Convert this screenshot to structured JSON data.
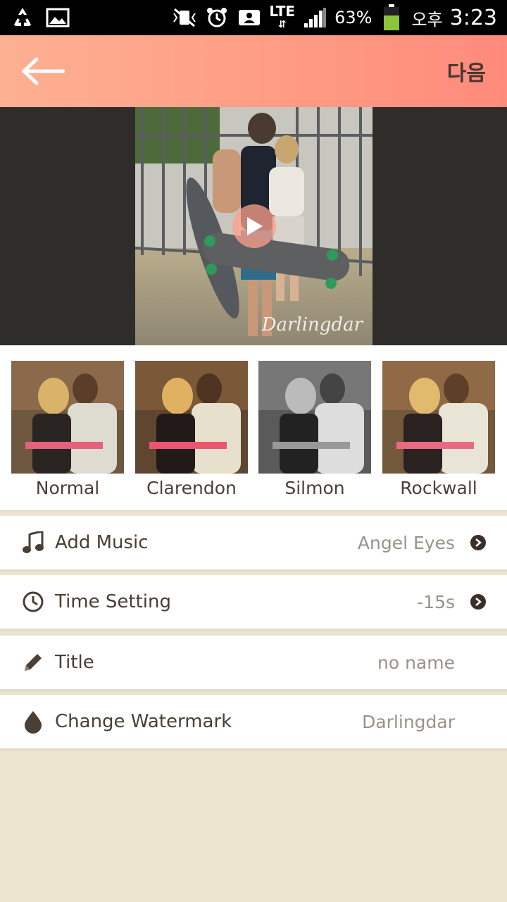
{
  "status_bar": {
    "battery_percent": "63%",
    "network": "LTE",
    "ampm": "오후",
    "time": "3:23"
  },
  "action_bar": {
    "back_icon": "arrow-left-icon",
    "next_label": "다음"
  },
  "preview": {
    "watermark": "Darlingdar",
    "play_icon": "play-icon"
  },
  "filters": [
    {
      "label": "Normal"
    },
    {
      "label": "Clarendon"
    },
    {
      "label": "Silmon"
    },
    {
      "label": "Rockwall"
    }
  ],
  "settings": {
    "music": {
      "label": "Add Music",
      "value": "Angel Eyes",
      "icon": "music-note-icon"
    },
    "time": {
      "label": "Time Setting",
      "value": "-15s",
      "icon": "clock-icon"
    },
    "title": {
      "label": "Title",
      "value": "no name",
      "icon": "pencil-icon"
    },
    "watermark": {
      "label": "Change Watermark",
      "value": "Darlingdar",
      "icon": "drop-icon"
    }
  },
  "colors": {
    "accent_start": "#fdb092",
    "accent_end": "#fe8a7c",
    "background": "#ede5d0",
    "text_dark": "#4a3f35",
    "text_muted": "#9a9288"
  }
}
